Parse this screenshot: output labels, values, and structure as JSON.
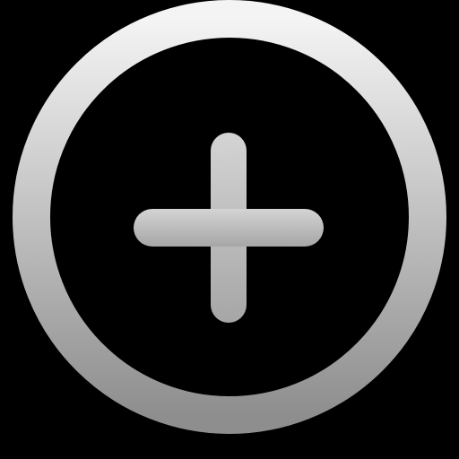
{
  "icon": {
    "name": "add-circle-icon",
    "background_color": "#000000",
    "gradient": {
      "top_color": "#f4f4f4",
      "bottom_color": "#8e8e8e"
    }
  }
}
